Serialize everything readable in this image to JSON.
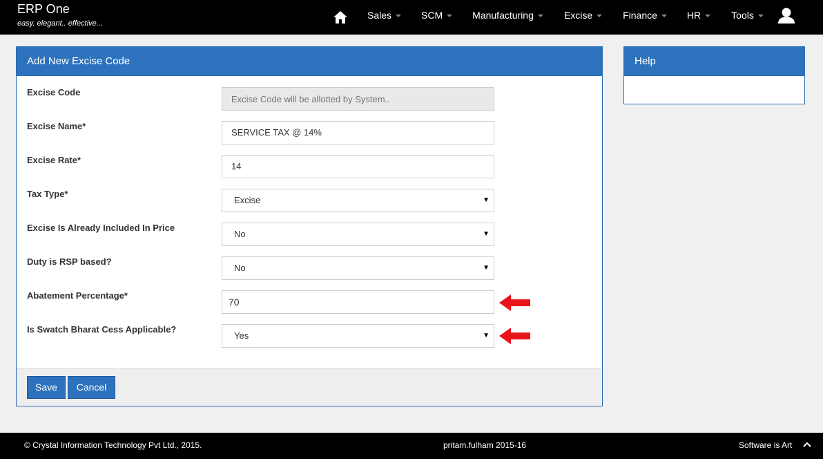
{
  "app": {
    "title": "ERP One",
    "tagline": "easy. elegant.. effective..."
  },
  "nav": {
    "home_icon": "home-icon",
    "items": [
      {
        "label": "Sales"
      },
      {
        "label": "SCM"
      },
      {
        "label": "Manufacturing"
      },
      {
        "label": "Excise"
      },
      {
        "label": "Finance"
      },
      {
        "label": "HR"
      },
      {
        "label": "Tools"
      }
    ],
    "user_icon": "user-icon"
  },
  "form": {
    "title": "Add New Excise Code",
    "fields": [
      {
        "label": "Excise Code",
        "value": "",
        "placeholder": "Excise Code will be allotted by System.."
      },
      {
        "label": "Excise Name*",
        "value": "SERVICE TAX @ 14%"
      },
      {
        "label": "Excise Rate*",
        "value": "14"
      },
      {
        "label": "Tax Type*",
        "value": "Excise"
      },
      {
        "label": "Excise Is Already Included In Price",
        "value": "No"
      },
      {
        "label": "Duty is RSP based?",
        "value": "No"
      },
      {
        "label": "Abatement Percentage*",
        "value": "70"
      },
      {
        "label": "Is Swatch Bharat Cess Applicable?",
        "value": "Yes"
      }
    ],
    "save_label": "Save",
    "cancel_label": "Cancel"
  },
  "help": {
    "title": "Help"
  },
  "footer": {
    "copyright": "© Crystal Information Technology Pvt Ltd., 2015.",
    "user_session": "pritam.fulham 2015-16",
    "motto": "Software is Art"
  },
  "colors": {
    "navbar": "#000000",
    "panel_heading": "#2d72bd",
    "annotation_arrow": "#e8151b"
  }
}
